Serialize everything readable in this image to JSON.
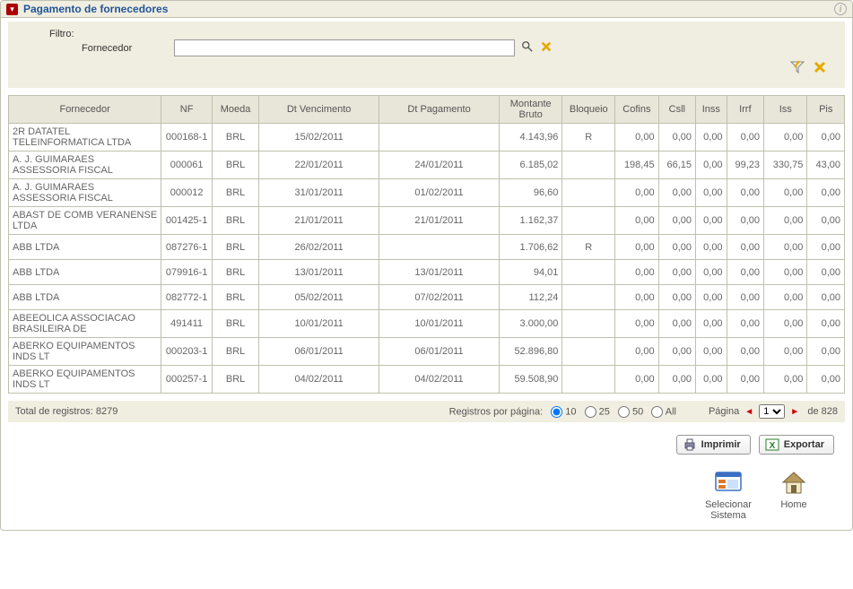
{
  "panel": {
    "title": "Pagamento de fornecedores"
  },
  "filter": {
    "label": "Filtro:",
    "field_label": "Fornecedor",
    "value": ""
  },
  "columns": {
    "fornecedor": "Fornecedor",
    "nf": "NF",
    "moeda": "Moeda",
    "dt_vencimento": "Dt Vencimento",
    "dt_pagamento": "Dt Pagamento",
    "montante_bruto": "Montante Bruto",
    "bloqueio": "Bloqueio",
    "cofins": "Cofins",
    "csll": "Csll",
    "inss": "Inss",
    "irrf": "Irrf",
    "iss": "Iss",
    "pis": "Pis"
  },
  "rows": [
    {
      "fornecedor": "2R DATATEL TELEINFORMATICA LTDA",
      "nf": "000168-1",
      "moeda": "BRL",
      "dt_vencimento": "15/02/2011",
      "dt_pagamento": "",
      "montante_bruto": "4.143,96",
      "bloqueio": "R",
      "cofins": "0,00",
      "csll": "0,00",
      "inss": "0,00",
      "irrf": "0,00",
      "iss": "0,00",
      "pis": "0,00"
    },
    {
      "fornecedor": "A. J. GUIMARAES ASSESSORIA FISCAL",
      "nf": "000061",
      "moeda": "BRL",
      "dt_vencimento": "22/01/2011",
      "dt_pagamento": "24/01/2011",
      "montante_bruto": "6.185,02",
      "bloqueio": "",
      "cofins": "198,45",
      "csll": "66,15",
      "inss": "0,00",
      "irrf": "99,23",
      "iss": "330,75",
      "pis": "43,00"
    },
    {
      "fornecedor": "A. J. GUIMARAES ASSESSORIA FISCAL",
      "nf": "000012",
      "moeda": "BRL",
      "dt_vencimento": "31/01/2011",
      "dt_pagamento": "01/02/2011",
      "montante_bruto": "96,60",
      "bloqueio": "",
      "cofins": "0,00",
      "csll": "0,00",
      "inss": "0,00",
      "irrf": "0,00",
      "iss": "0,00",
      "pis": "0,00"
    },
    {
      "fornecedor": "ABAST DE COMB VERANENSE LTDA",
      "nf": "001425-1",
      "moeda": "BRL",
      "dt_vencimento": "21/01/2011",
      "dt_pagamento": "21/01/2011",
      "montante_bruto": "1.162,37",
      "bloqueio": "",
      "cofins": "0,00",
      "csll": "0,00",
      "inss": "0,00",
      "irrf": "0,00",
      "iss": "0,00",
      "pis": "0,00"
    },
    {
      "fornecedor": "ABB LTDA",
      "nf": "087276-1",
      "moeda": "BRL",
      "dt_vencimento": "26/02/2011",
      "dt_pagamento": "",
      "montante_bruto": "1.706,62",
      "bloqueio": "R",
      "cofins": "0,00",
      "csll": "0,00",
      "inss": "0,00",
      "irrf": "0,00",
      "iss": "0,00",
      "pis": "0,00"
    },
    {
      "fornecedor": "ABB LTDA",
      "nf": "079916-1",
      "moeda": "BRL",
      "dt_vencimento": "13/01/2011",
      "dt_pagamento": "13/01/2011",
      "montante_bruto": "94,01",
      "bloqueio": "",
      "cofins": "0,00",
      "csll": "0,00",
      "inss": "0,00",
      "irrf": "0,00",
      "iss": "0,00",
      "pis": "0,00"
    },
    {
      "fornecedor": "ABB LTDA",
      "nf": "082772-1",
      "moeda": "BRL",
      "dt_vencimento": "05/02/2011",
      "dt_pagamento": "07/02/2011",
      "montante_bruto": "112,24",
      "bloqueio": "",
      "cofins": "0,00",
      "csll": "0,00",
      "inss": "0,00",
      "irrf": "0,00",
      "iss": "0,00",
      "pis": "0,00"
    },
    {
      "fornecedor": "ABEEOLICA ASSOCIACAO BRASILEIRA DE",
      "nf": "491411",
      "moeda": "BRL",
      "dt_vencimento": "10/01/2011",
      "dt_pagamento": "10/01/2011",
      "montante_bruto": "3.000,00",
      "bloqueio": "",
      "cofins": "0,00",
      "csll": "0,00",
      "inss": "0,00",
      "irrf": "0,00",
      "iss": "0,00",
      "pis": "0,00"
    },
    {
      "fornecedor": "ABERKO EQUIPAMENTOS INDS LT",
      "nf": "000203-1",
      "moeda": "BRL",
      "dt_vencimento": "06/01/2011",
      "dt_pagamento": "06/01/2011",
      "montante_bruto": "52.896,80",
      "bloqueio": "",
      "cofins": "0,00",
      "csll": "0,00",
      "inss": "0,00",
      "irrf": "0,00",
      "iss": "0,00",
      "pis": "0,00"
    },
    {
      "fornecedor": "ABERKO EQUIPAMENTOS INDS LT",
      "nf": "000257-1",
      "moeda": "BRL",
      "dt_vencimento": "04/02/2011",
      "dt_pagamento": "04/02/2011",
      "montante_bruto": "59.508,90",
      "bloqueio": "",
      "cofins": "0,00",
      "csll": "0,00",
      "inss": "0,00",
      "irrf": "0,00",
      "iss": "0,00",
      "pis": "0,00"
    }
  ],
  "footer": {
    "total_label": "Total de registros: 8279",
    "per_page_label": "Registros por página:",
    "options": {
      "o10": "10",
      "o25": "25",
      "o50": "50",
      "oAll": "All"
    },
    "page_label": "Página",
    "current_page": "1",
    "of_label": "de",
    "total_pages": "828"
  },
  "buttons": {
    "print": "Imprimir",
    "export": "Exportar"
  },
  "nav": {
    "select_system": "Selecionar Sistema",
    "home": "Home"
  }
}
